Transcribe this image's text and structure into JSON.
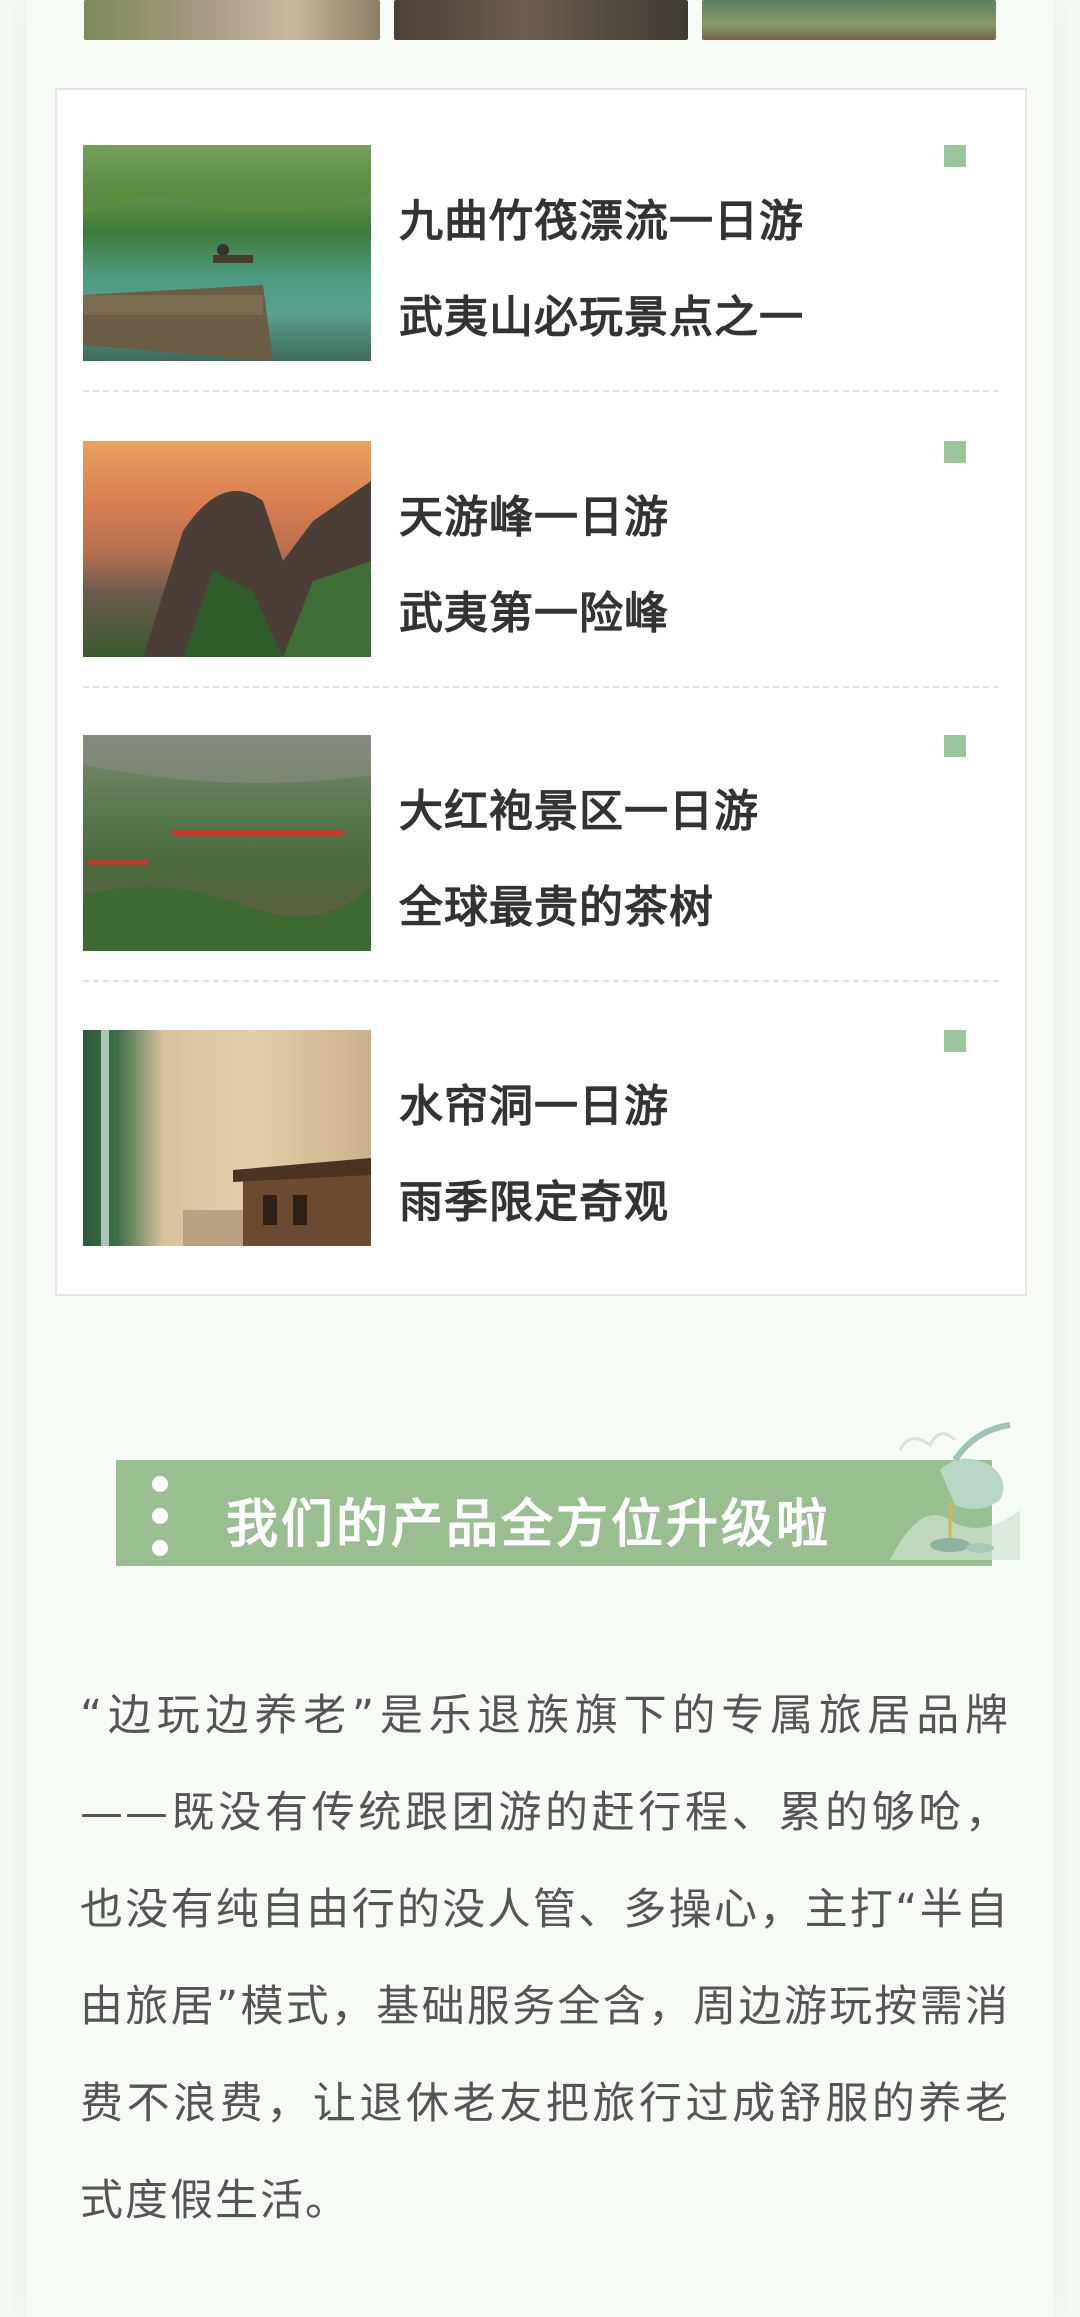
{
  "attractions": [
    {
      "title": "九曲竹筏漂流一日游",
      "subtitle": "武夷山必玩景点之一"
    },
    {
      "title": "天游峰一日游",
      "subtitle": "武夷第一险峰"
    },
    {
      "title": "大红袍景区一日游",
      "subtitle": "全球最贵的茶树"
    },
    {
      "title": "水帘洞一日游",
      "subtitle": "雨季限定奇观"
    }
  ],
  "section": {
    "heading": "我们的产品全方位升级啦",
    "description": "“边玩边养老”是乐退族旗下的专属旅居品牌——既没有传统跟团游的赶行程、累的够呛，也没有纯自由行的没人管、多操心，主打“半自由旅居”模式，基础服务全含，周边游玩按需消费不浪费，让退休老友把旅行过成舒服的养老式度假生活。"
  },
  "colors": {
    "accent_green": "#99bf91",
    "marker_green": "#9bc59a",
    "title_text": "#333333",
    "body_text": "#555555"
  }
}
